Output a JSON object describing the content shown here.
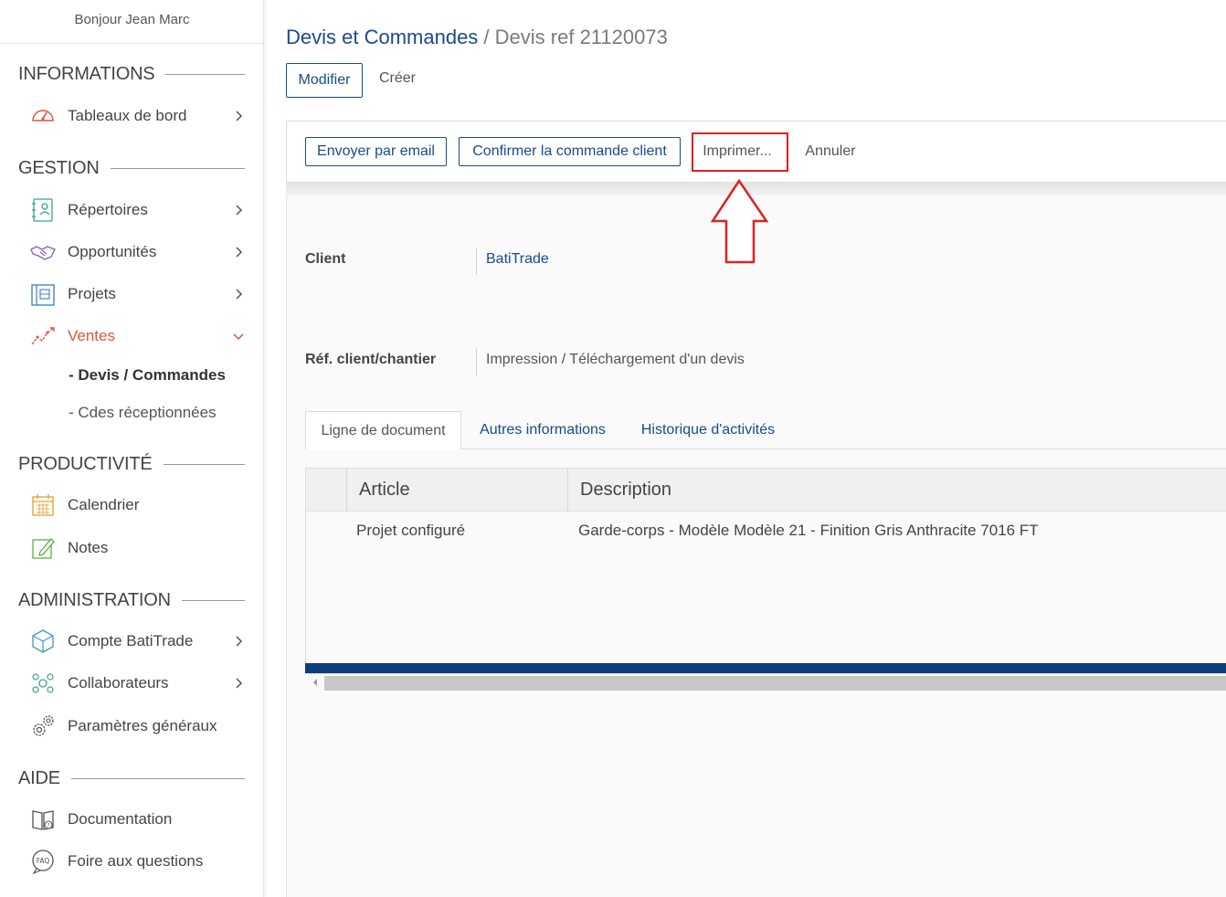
{
  "sidebar": {
    "greeting": "Bonjour Jean Marc",
    "sections": {
      "informations": "INFORMATIONS",
      "gestion": "GESTION",
      "productivite": "PRODUCTIVITÉ",
      "administration": "ADMINISTRATION",
      "aide": "AIDE"
    },
    "items": {
      "tableaux": "Tableaux de bord",
      "repertoires": "Répertoires",
      "opportunites": "Opportunités",
      "projets": "Projets",
      "ventes": "Ventes",
      "devis": "- Devis / Commandes",
      "cdes": "- Cdes réceptionnées",
      "calendrier": "Calendrier",
      "notes": "Notes",
      "compte": "Compte BatiTrade",
      "collaborateurs": "Collaborateurs",
      "parametres": "Paramètres généraux",
      "documentation": "Documentation",
      "faq": "Foire aux questions"
    },
    "icons": {
      "tableaux": "dashboard-gauge-icon",
      "repertoires": "contacts-icon",
      "opportunites": "handshake-icon",
      "projets": "blueprint-icon",
      "ventes": "sales-chart-icon",
      "calendrier": "calendar-icon",
      "notes": "notes-edit-icon",
      "compte": "cube-icon",
      "collaborateurs": "team-icon",
      "parametres": "gears-icon",
      "documentation": "book-icon",
      "faq": "faq-icon"
    }
  },
  "header": {
    "breadcrumb": "Devis et Commandes",
    "separator": " / ",
    "page_title": "Devis ref 21120073"
  },
  "mode_tabs": {
    "modifier": "Modifier",
    "creer": "Créer"
  },
  "toolbar": {
    "email": "Envoyer par email",
    "confirm": "Confirmer la commande client",
    "print": "Imprimer...",
    "cancel": "Annuler"
  },
  "form": {
    "client_label": "Client",
    "client_value": "BatiTrade",
    "ref_label": "Réf. client/chantier",
    "ref_value": "Impression / Téléchargement d'un devis"
  },
  "doc_tabs": {
    "ligne": "Ligne de document",
    "autres": "Autres informations",
    "historique": "Historique d'activités"
  },
  "grid": {
    "columns": [
      "Article",
      "Description"
    ],
    "rows": [
      [
        "Projet configuré",
        "Garde-corps - Modèle Modèle 21 - Finition Gris Anthracite 7016 FT"
      ]
    ]
  },
  "colors": {
    "primary": "#1a4a8a",
    "active_nav": "#e0533a",
    "highlight": "#e02020",
    "grid_bar": "#0d3d7a"
  }
}
